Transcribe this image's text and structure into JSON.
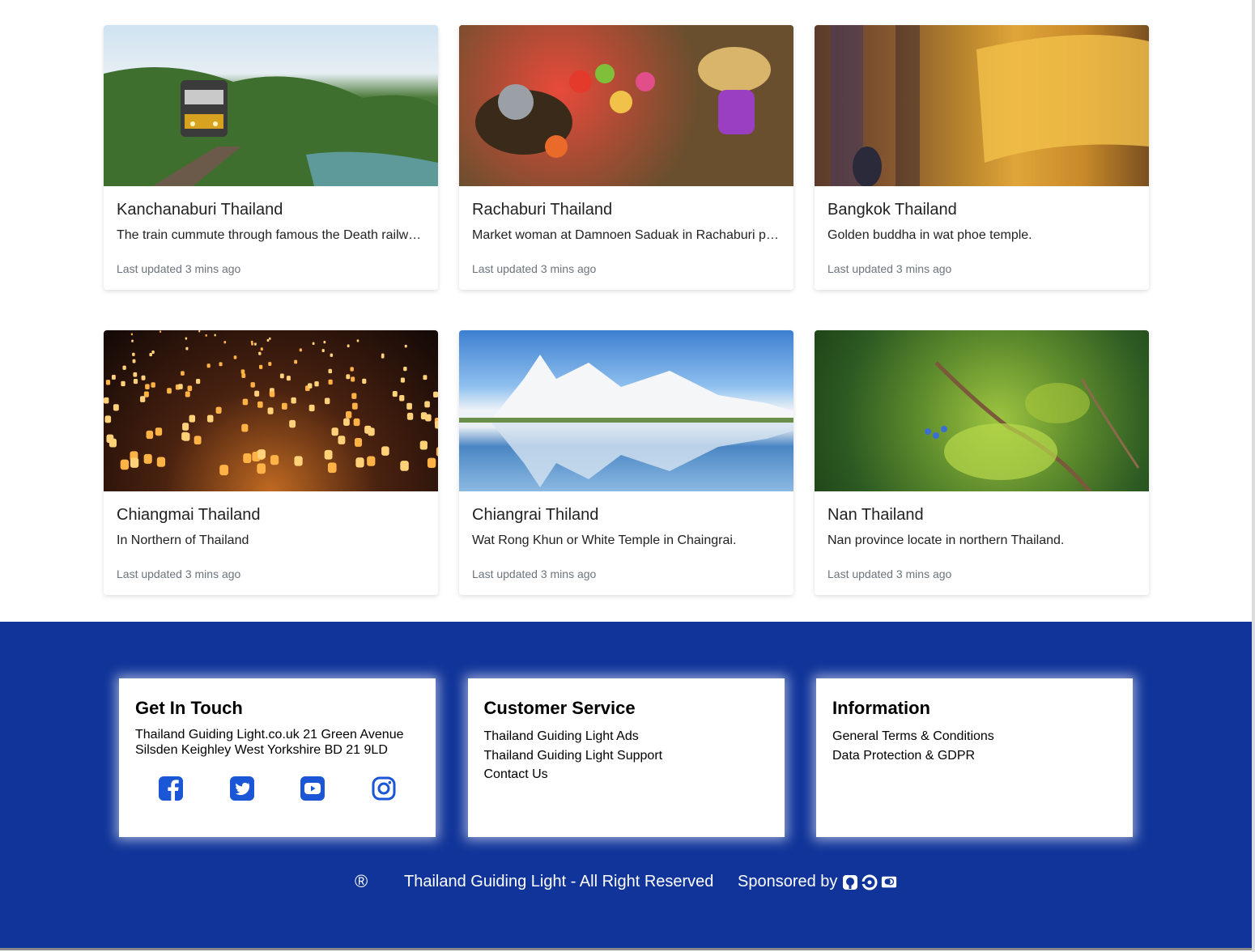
{
  "cards": [
    {
      "title": "Kanchanaburi Thailand",
      "text": "The train cummute through famous the Death railway bridge in Kanchanaburi.",
      "updated": "Last updated 3 mins ago",
      "image": "train-on-death-railway"
    },
    {
      "title": "Rachaburi Thailand",
      "text": "Market woman at Damnoen Saduak in Rachaburi province.",
      "updated": "Last updated 3 mins ago",
      "image": "floating-market"
    },
    {
      "title": "Bangkok Thailand",
      "text": "Golden buddha in wat phoe temple.",
      "updated": "Last updated 3 mins ago",
      "image": "golden-buddha"
    },
    {
      "title": "Chiangmai Thailand",
      "text": "In Northern of Thailand",
      "updated": "Last updated 3 mins ago",
      "image": "floating-lanterns"
    },
    {
      "title": "Chiangrai Thiland",
      "text": "Wat Rong Khun or White Temple in Chaingrai.",
      "updated": "Last updated 3 mins ago",
      "image": "white-temple"
    },
    {
      "title": "Nan Thailand",
      "text": "Nan province locate in northern Thailand.",
      "updated": "Last updated 3 mins ago",
      "image": "rice-fields"
    }
  ],
  "footer": {
    "get_in_touch": {
      "title": "Get In Touch",
      "address_line1": "Thailand Guiding Light.co.uk 21 Green Avenue",
      "address_line2": "Silsden Keighley West Yorkshire BD 21 9LD",
      "socials": [
        "facebook-icon",
        "twitter-icon",
        "youtube-icon",
        "instagram-icon"
      ]
    },
    "customer_service": {
      "title": "Customer Service",
      "links": [
        "Thailand Guiding Light Ads",
        "Thailand Guiding Light Support",
        "Contact Us"
      ]
    },
    "information": {
      "title": "Information",
      "links": [
        "General Terms & Conditions",
        "Data Protection & GDPR"
      ]
    },
    "registered_symbol": "®",
    "rights": "Thailand Guiding Light - All Right Reserved",
    "sponsored_by": "Sponsored by",
    "sponsor_icons": [
      "github-icon",
      "circleci-icon",
      "mastercard-icon"
    ],
    "background_color": "#103499",
    "icon_color": "#1a56d6"
  }
}
